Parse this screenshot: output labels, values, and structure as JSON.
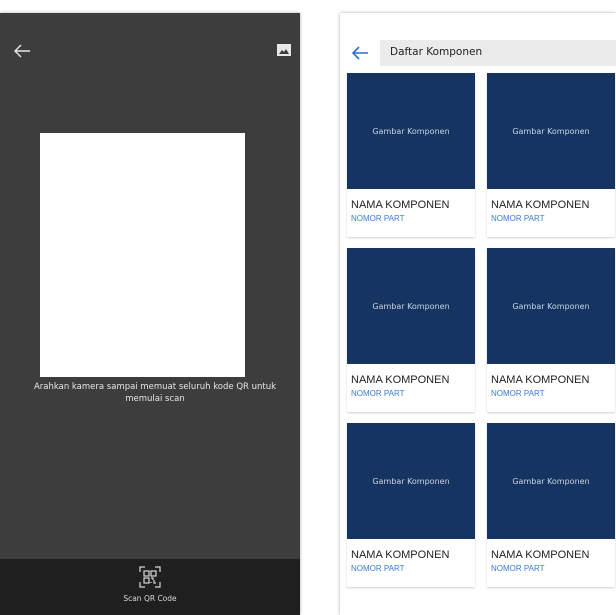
{
  "scanner": {
    "instruction": "Arahkan kamera sampai memuat seluruh kode QR untuk memulai scan",
    "scan_label": "Scan QR Code",
    "icons": {
      "back": "arrow-left-icon",
      "gallery": "image-icon",
      "scan": "qr-code-icon"
    }
  },
  "catalog": {
    "title": "Daftar Komponen",
    "icons": {
      "back": "arrow-left-icon",
      "camera": "camera-icon"
    },
    "accent": "#3a7bd5",
    "card_color": "#163462",
    "cards": [
      {
        "image_text": "Gambar Komponen",
        "name": "NAMA KOMPONEN",
        "part": "NOMOR PART"
      },
      {
        "image_text": "Gambar Komponen",
        "name": "NAMA KOMPONEN",
        "part": "NOMOR PART"
      },
      {
        "image_text": "Gambar Komponen",
        "name": "NAMA KOMPONEN",
        "part": "NOMOR PART"
      },
      {
        "image_text": "Gambar Komponen",
        "name": "NAMA KOMPONEN",
        "part": "NOMOR PART"
      },
      {
        "image_text": "Gambar Komponen",
        "name": "NAMA KOMPONEN",
        "part": "NOMOR PART"
      },
      {
        "image_text": "Gambar Komponen",
        "name": "NAMA KOMPONEN",
        "part": "NOMOR PART"
      }
    ]
  }
}
